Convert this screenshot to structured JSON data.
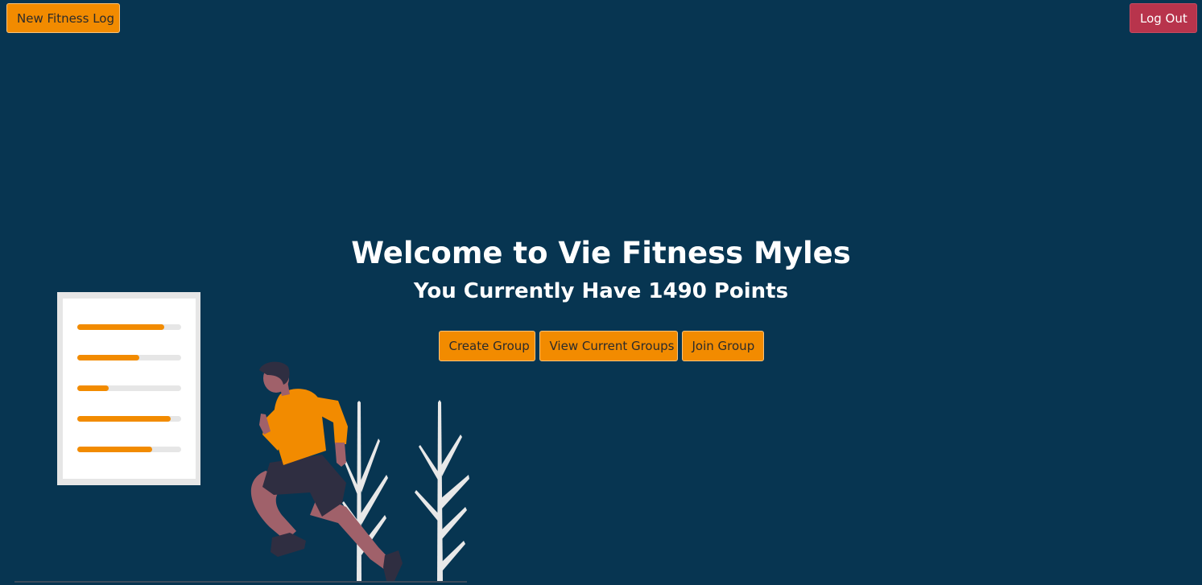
{
  "header": {
    "new_log_label": "New Fitness Log",
    "logout_label": "Log Out"
  },
  "welcome": {
    "title": "Welcome to Vie Fitness Myles",
    "points_text": "You Currently Have 1490 Points"
  },
  "group_actions": {
    "create_label": "Create Group",
    "view_label": "View Current Groups",
    "join_label": "Join Group"
  },
  "illustration": {
    "progress_levels": [
      0.84,
      0.6,
      0.3,
      0.9,
      0.72
    ]
  },
  "colors": {
    "background": "#073551",
    "accent": "#f28b00",
    "danger": "#b8344c"
  }
}
